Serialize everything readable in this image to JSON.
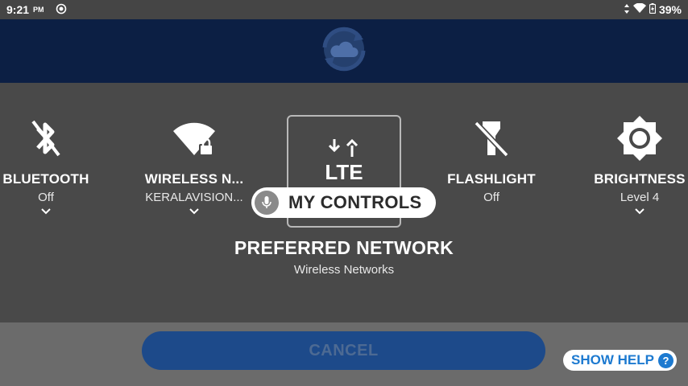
{
  "status_bar": {
    "time": "9:21",
    "ampm": "PM",
    "battery": "39%"
  },
  "header": {
    "icon": "cloud-sync-icon"
  },
  "tiles": {
    "bluetooth": {
      "label": "BLUETOOTH",
      "value": "Off",
      "icon": "bluetooth-off-icon"
    },
    "wireless": {
      "label": "WIRELESS N...",
      "value": "KERALAVISION...",
      "icon": "wifi-locked-icon"
    },
    "preferred": {
      "icon": "lte-icon",
      "icon_text": "LTE"
    },
    "flashlight": {
      "label": "FLASHLIGHT",
      "value": "Off",
      "icon": "flashlight-off-icon"
    },
    "brightness": {
      "label": "BRIGHTNESS",
      "value": "Level 4",
      "icon": "brightness-icon"
    }
  },
  "selected": {
    "title": "PREFERRED NETWORK",
    "subtitle": "Wireless Networks"
  },
  "voice": {
    "label": "MY CONTROLS",
    "icon": "mic-icon"
  },
  "bottom": {
    "cancel_label": "CANCEL",
    "help_label": "SHOW HELP",
    "help_icon": "?"
  },
  "colors": {
    "header_bg": "#0c1f44",
    "panel_bg": "#494949",
    "cancel_bg": "#1d4a8a",
    "help_accent": "#1d7ad0"
  }
}
